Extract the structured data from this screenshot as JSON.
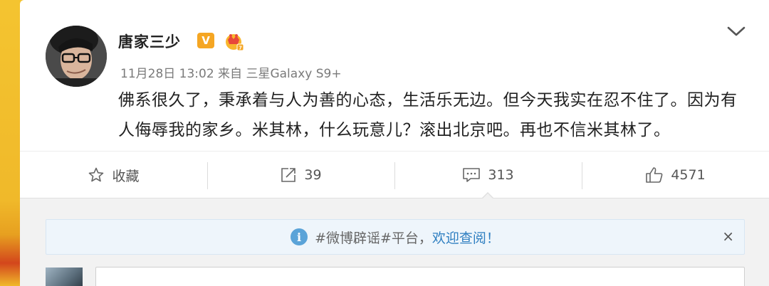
{
  "post": {
    "username": "唐家三少",
    "verified_badge": "V",
    "meta": "11月28日 13:02 来自 三星Galaxy S9+",
    "content": "佛系很久了，秉承着与人为善的心态，生活乐无边。但今天我实在忍不住了。因为有人侮辱我的家乡。米其林，什么玩意儿？滚出北京吧。再也不信米其林了。"
  },
  "actions": {
    "favorite": "收藏",
    "repost": "39",
    "comment": "313",
    "like": "4571"
  },
  "notice": {
    "prefix": "#微博辟谣#平台，",
    "link": "欢迎查阅！",
    "close": "×"
  },
  "icons": {
    "more": "chevron-down-icon",
    "favorite": "star-icon",
    "repost": "share-icon",
    "comment": "comment-icon",
    "like": "thumb-up-icon",
    "info": "info-icon",
    "crown": "crown-icon"
  },
  "colors": {
    "badge": "#f5a623",
    "link": "#2f7fc1",
    "notice_bg": "#eef5fb",
    "info": "#5aa3d8"
  }
}
